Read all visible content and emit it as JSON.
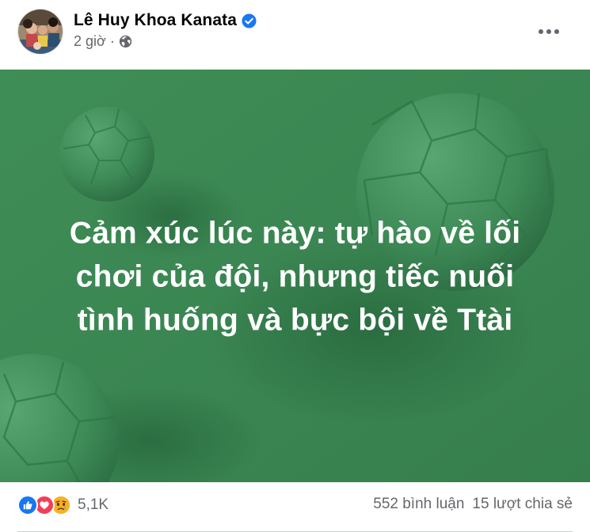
{
  "post": {
    "author": "Lê Huy Khoa Kanata",
    "time": "2 giờ",
    "separator": "·",
    "privacy_icon": "globe-icon",
    "verified_icon": "verified-badge-icon",
    "more_icon": "more-options-icon",
    "background_color": "#3c8a55",
    "text": "Cảm xúc lúc này: tự hào về lối chơi của đội, nhưng tiếc nuối tình huống và bực bội về Ttài",
    "text_lines": [
      "Cảm xúc lúc này: tự hào về lối",
      "chơi của đội, nhưng tiếc nuối",
      "tình huống và bực bội về Ttài"
    ]
  },
  "reactions": {
    "icons": [
      "like-reaction-icon",
      "love-reaction-icon",
      "sad-reaction-icon"
    ],
    "count": "5,1K"
  },
  "stats": {
    "comments": "552 bình luận",
    "shares": "15 lượt chia sẻ"
  },
  "colors": {
    "like": "#1877f2",
    "love": "#f33e58",
    "sad": "#f7b125",
    "verified": "#1877f2"
  }
}
